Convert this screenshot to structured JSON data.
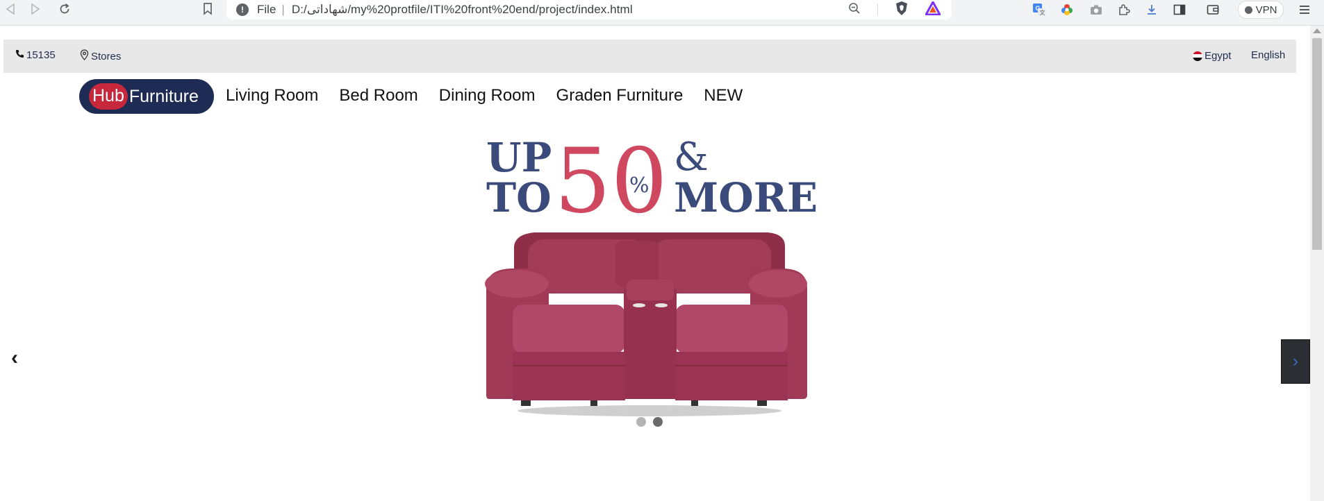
{
  "browser": {
    "url_scheme": "File",
    "url": "D:/شهاداتى/my%20protfile/ITI%20front%20end/project/index.html",
    "vpn_label": "VPN"
  },
  "topbar": {
    "phone": "15135",
    "stores": "Stores",
    "country": "Egypt",
    "language": "English"
  },
  "nav": {
    "brand_hub": "Hub",
    "brand_rest": "Furniture",
    "links": [
      "Living Room",
      "Bed Room",
      "Dining Room",
      "Graden Furniture",
      "NEW"
    ]
  },
  "hero": {
    "line1a": "UP",
    "line1b": "TO",
    "big_number": "50",
    "percent": "%",
    "amp": "&",
    "more": "MORE",
    "colors": {
      "navy": "#3a4a7a",
      "red": "#cf4860",
      "sofa": "#9e3651"
    }
  },
  "carousel": {
    "prev_icon": "‹",
    "next_icon": "›",
    "slides": 2,
    "active_slide": 2
  },
  "colors": {
    "brand_navy": "#1d2b55",
    "brand_red": "#c8283c",
    "topbar_bg": "#e8e8e8"
  }
}
